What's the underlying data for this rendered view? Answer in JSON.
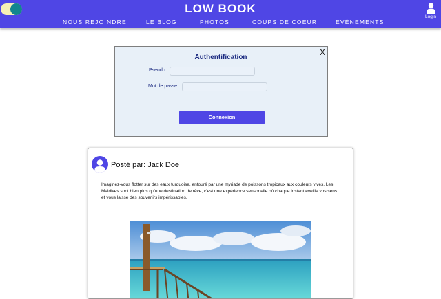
{
  "header": {
    "logo": "LOW BOOK",
    "nav": [
      "NOUS REJOINDRE",
      "LE BLOG",
      "PHOTOS",
      "COUPS DE COEUR",
      "EVÈNEMENTS"
    ],
    "login_label": "Login",
    "theme_toggle_icon": "toggle-icon",
    "login_icon": "user-icon"
  },
  "auth": {
    "title": "Authentification",
    "close_label": "X",
    "pseudo_label": "Pseudo :",
    "pseudo_value": "",
    "password_label": "Mot de passe :",
    "password_value": "",
    "submit_label": "Connexion"
  },
  "post": {
    "author_line": "Posté par: Jack Doe",
    "body": "Imaginez-vous flotter sur des eaux turquoise, entouré par une myriade de poissons tropicaux aux couleurs vives. Les Maldives sont bien plus qu'une destination de rêve, c'est une expérience sensorielle où chaque instant éveille vos sens et vous laisse des souvenirs impérissables.",
    "avatar_icon": "user-avatar-icon",
    "image": "maldives-beach-photo"
  },
  "colors": {
    "brand": "#4f46e5",
    "title_navy": "#1b2a80",
    "panel": "#e8f0f8"
  }
}
